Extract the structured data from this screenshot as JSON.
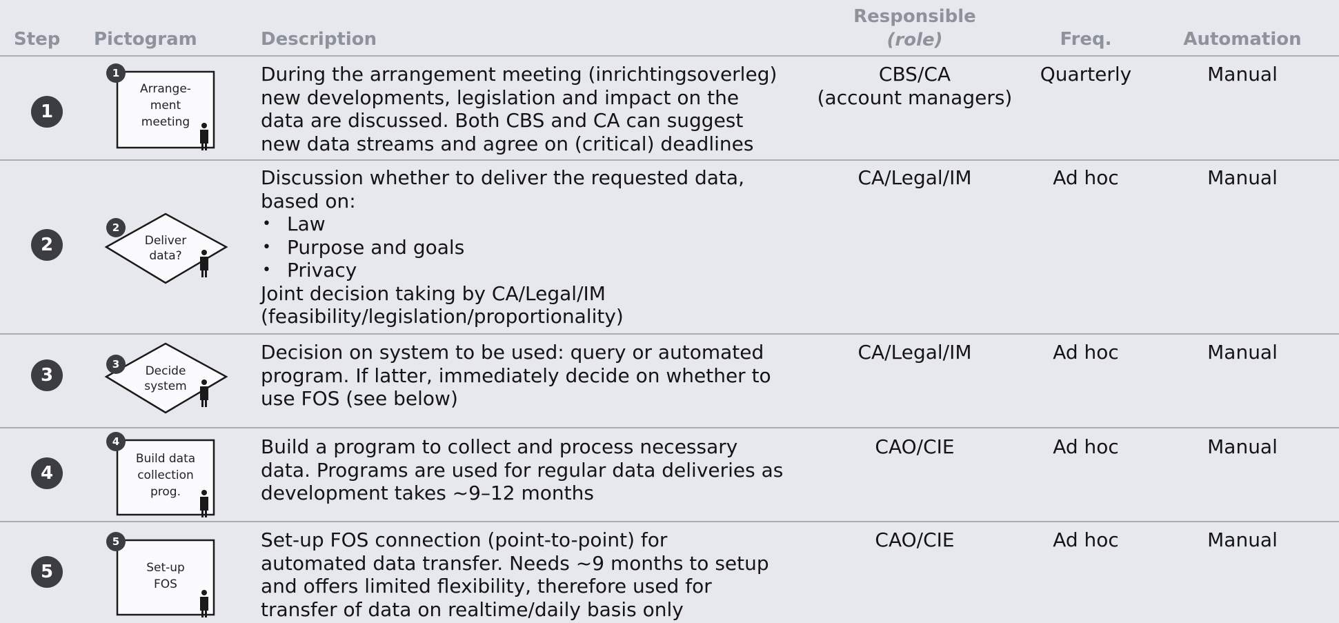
{
  "headers": {
    "step": "Step",
    "pictogram": "Pictogram",
    "description": "Description",
    "responsible": "Responsible",
    "responsible_sub": "(role)",
    "freq": "Freq.",
    "automation": "Automation"
  },
  "rows": [
    {
      "step": "1",
      "picto": {
        "shape": "box-icon",
        "num": "1",
        "lines": [
          "Arrange-",
          "ment",
          "meeting"
        ]
      },
      "desc": [
        "During the arrangement meeting (inrichtingsoverleg)",
        "new developments, legislation and impact on the",
        "data are discussed. Both CBS and CA can suggest",
        "new data streams and agree on (critical) deadlines"
      ],
      "resp": [
        "CBS/CA",
        "(account managers)"
      ],
      "freq": "Quarterly",
      "auto": "Manual"
    },
    {
      "step": "2",
      "picto": {
        "shape": "diamond-icon",
        "num": "2",
        "lines": [
          "Deliver",
          "data?"
        ]
      },
      "desc_intro": [
        "Discussion whether to deliver the requested data,",
        "based on:"
      ],
      "bullets": [
        "Law",
        "Purpose and goals",
        "Privacy"
      ],
      "desc_outro": [
        "Joint decision taking by CA/Legal/IM",
        "(feasibility/legislation/proportionality)"
      ],
      "resp": [
        "CA/Legal/IM"
      ],
      "freq": "Ad hoc",
      "auto": "Manual"
    },
    {
      "step": "3",
      "picto": {
        "shape": "diamond-icon",
        "num": "3",
        "lines": [
          "Decide",
          "system"
        ]
      },
      "desc": [
        "Decision on system to be used: query or automated",
        "program. If latter, immediately decide on whether to",
        "use FOS (see below)"
      ],
      "resp": [
        "CA/Legal/IM"
      ],
      "freq": "Ad hoc",
      "auto": "Manual"
    },
    {
      "step": "4",
      "picto": {
        "shape": "box-icon",
        "num": "4",
        "lines": [
          "Build data",
          "collection",
          "prog."
        ]
      },
      "desc": [
        "Build a program to collect and process necessary",
        "data. Programs are used for regular data deliveries as",
        "development takes ~9–12 months"
      ],
      "resp": [
        "CAO/CIE"
      ],
      "freq": "Ad hoc",
      "auto": "Manual"
    },
    {
      "step": "5",
      "picto": {
        "shape": "box-icon",
        "num": "5",
        "lines": [
          "Set-up",
          "FOS"
        ]
      },
      "desc": [
        "Set-up FOS connection (point-to-point) for",
        "automated data transfer. Needs ~9 months to setup",
        "and offers limited flexibility, therefore used for",
        "transfer of data on realtime/daily basis only"
      ],
      "resp": [
        "CAO/CIE"
      ],
      "freq": "Ad hoc",
      "auto": "Manual"
    }
  ],
  "icons": {
    "person": "person-icon"
  }
}
